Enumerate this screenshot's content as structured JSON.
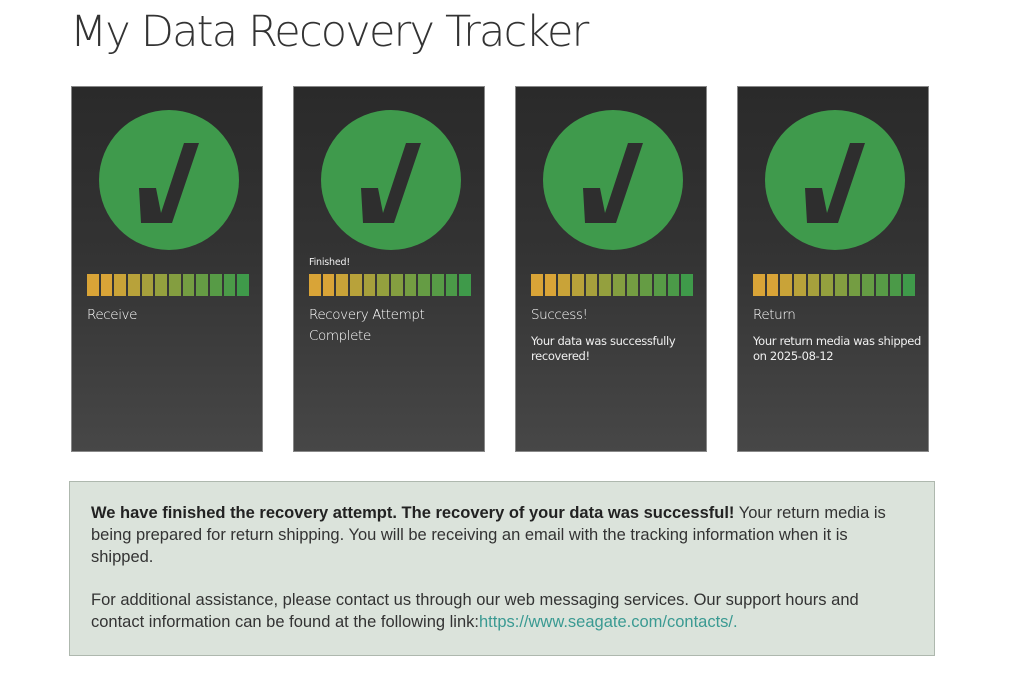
{
  "page": {
    "title": "My Data Recovery Tracker"
  },
  "colors": {
    "check_circle": "#3f9a4c",
    "check_mark": "#2e2e2e",
    "card_background": "#333333",
    "message_background": "#dbe3db",
    "link": "#3a9a92",
    "progress_segments": [
      "#d9a437",
      "#d9a437",
      "#c9a338",
      "#b8a23a",
      "#a6a03c",
      "#94a03e",
      "#849e40",
      "#749d42",
      "#659c44",
      "#579b46",
      "#4b9a48",
      "#3f9a4a"
    ]
  },
  "steps": [
    {
      "label": "Receive",
      "note": "",
      "description": "",
      "icon": "check-mark-icon",
      "progress_segments": 12
    },
    {
      "label": "Recovery Attempt Complete",
      "note": "Finished!",
      "description": "",
      "icon": "check-mark-icon",
      "progress_segments": 12
    },
    {
      "label": "Success!",
      "note": "",
      "description": "Your data was successfully recovered!",
      "icon": "check-mark-icon",
      "progress_segments": 12
    },
    {
      "label": "Return",
      "note": "",
      "description": "Your return media was shipped on 2025-08-12",
      "icon": "check-mark-icon",
      "progress_segments": 12
    }
  ],
  "message": {
    "bold": "We have finished the recovery attempt. The recovery of your data was successful!",
    "body": " Your return media is being prepared for return shipping. You will be receiving an email with the tracking information when it is shipped.",
    "assistance": "For additional assistance, please contact us through our web messaging services. Our support hours and contact information can be found at the following link:",
    "link_text": "https://www.seagate.com/contacts/."
  }
}
